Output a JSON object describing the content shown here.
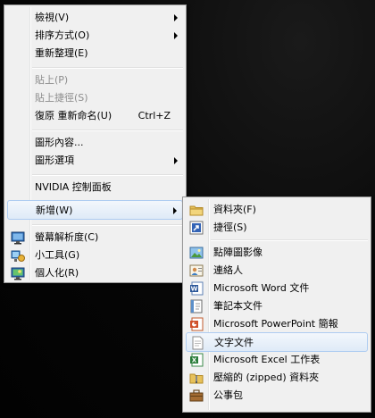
{
  "context_menu": {
    "view": "檢視(V)",
    "sort_by": "排序方式(O)",
    "refresh": "重新整理(E)",
    "paste": "貼上(P)",
    "paste_shortcut": "貼上捷徑(S)",
    "undo_rename": "復原 重新命名(U)",
    "undo_rename_key": "Ctrl+Z",
    "graphics_properties": "圖形內容...",
    "graphics_options": "圖形選項",
    "nvidia_control_panel": "NVIDIA 控制面板",
    "new": "新增(W)",
    "screen_resolution": "螢幕解析度(C)",
    "gadgets": "小工具(G)",
    "personalize": "個人化(R)"
  },
  "new_submenu": {
    "folder": "資料夾(F)",
    "shortcut": "捷徑(S)",
    "bitmap_image": "點陣圖影像",
    "contact": "連絡人",
    "word_document": "Microsoft Word 文件",
    "journal_document": "筆記本文件",
    "powerpoint_presentation": "Microsoft PowerPoint 簡報",
    "text_document": "文字文件",
    "excel_worksheet": "Microsoft Excel 工作表",
    "zipped_folder": "壓縮的 (zipped) 資料夾",
    "briefcase": "公事包"
  },
  "colors": {
    "menu_bg": "#f0f0f0",
    "highlight_border": "#aeccf1",
    "disabled_text": "#8d8d8d"
  }
}
